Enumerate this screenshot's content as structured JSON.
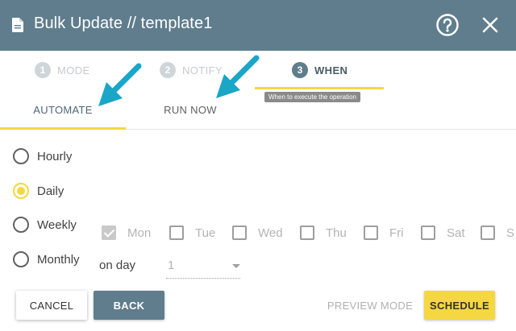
{
  "header": {
    "title": "Bulk Update // template1",
    "background": "#5f7d8c"
  },
  "stepper": {
    "steps": [
      {
        "number": "1",
        "label": "MODE"
      },
      {
        "number": "2",
        "label": "NOTIFY"
      },
      {
        "number": "3",
        "label": "WHEN",
        "active": true
      }
    ],
    "tooltip": "When to execute the operation"
  },
  "tabs": [
    {
      "label": "AUTOMATE",
      "active": true
    },
    {
      "label": "RUN NOW"
    }
  ],
  "schedule": {
    "options": [
      {
        "label": "Hourly"
      },
      {
        "label": "Daily",
        "checked": true
      },
      {
        "label": "Weekly"
      },
      {
        "label": "Monthly"
      }
    ],
    "days": [
      {
        "label": "Mon",
        "checked": true
      },
      {
        "label": "Tue"
      },
      {
        "label": "Wed"
      },
      {
        "label": "Thu"
      },
      {
        "label": "Fri"
      },
      {
        "label": "Sat"
      },
      {
        "label": "S"
      }
    ],
    "on_day_label": "on day",
    "on_day_value": "1"
  },
  "buttons": {
    "cancel": "CANCEL",
    "back": "BACK",
    "preview": "PREVIEW MODE",
    "schedule": "SCHEDULE"
  },
  "colors": {
    "accent": "#f5d742",
    "primary": "#5f7d8c",
    "arrow": "#1aa6c7"
  },
  "icons": {
    "doc": "document-icon",
    "help": "help-circle-icon",
    "close": "close-icon",
    "arrow": "pointer-arrow-icon"
  }
}
